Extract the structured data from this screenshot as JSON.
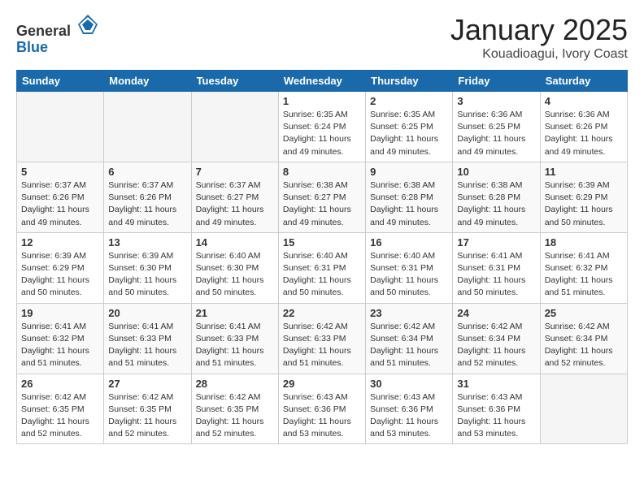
{
  "header": {
    "logo_general": "General",
    "logo_blue": "Blue",
    "title": "January 2025",
    "subtitle": "Kouadioagui, Ivory Coast"
  },
  "days_of_week": [
    "Sunday",
    "Monday",
    "Tuesday",
    "Wednesday",
    "Thursday",
    "Friday",
    "Saturday"
  ],
  "weeks": [
    [
      {
        "num": "",
        "info": "",
        "empty": true
      },
      {
        "num": "",
        "info": "",
        "empty": true
      },
      {
        "num": "",
        "info": "",
        "empty": true
      },
      {
        "num": "1",
        "sunrise": "6:35 AM",
        "sunset": "6:24 PM",
        "daylight": "11 hours and 49 minutes."
      },
      {
        "num": "2",
        "sunrise": "6:35 AM",
        "sunset": "6:25 PM",
        "daylight": "11 hours and 49 minutes."
      },
      {
        "num": "3",
        "sunrise": "6:36 AM",
        "sunset": "6:25 PM",
        "daylight": "11 hours and 49 minutes."
      },
      {
        "num": "4",
        "sunrise": "6:36 AM",
        "sunset": "6:26 PM",
        "daylight": "11 hours and 49 minutes."
      }
    ],
    [
      {
        "num": "5",
        "sunrise": "6:37 AM",
        "sunset": "6:26 PM",
        "daylight": "11 hours and 49 minutes."
      },
      {
        "num": "6",
        "sunrise": "6:37 AM",
        "sunset": "6:26 PM",
        "daylight": "11 hours and 49 minutes."
      },
      {
        "num": "7",
        "sunrise": "6:37 AM",
        "sunset": "6:27 PM",
        "daylight": "11 hours and 49 minutes."
      },
      {
        "num": "8",
        "sunrise": "6:38 AM",
        "sunset": "6:27 PM",
        "daylight": "11 hours and 49 minutes."
      },
      {
        "num": "9",
        "sunrise": "6:38 AM",
        "sunset": "6:28 PM",
        "daylight": "11 hours and 49 minutes."
      },
      {
        "num": "10",
        "sunrise": "6:38 AM",
        "sunset": "6:28 PM",
        "daylight": "11 hours and 49 minutes."
      },
      {
        "num": "11",
        "sunrise": "6:39 AM",
        "sunset": "6:29 PM",
        "daylight": "11 hours and 50 minutes."
      }
    ],
    [
      {
        "num": "12",
        "sunrise": "6:39 AM",
        "sunset": "6:29 PM",
        "daylight": "11 hours and 50 minutes."
      },
      {
        "num": "13",
        "sunrise": "6:39 AM",
        "sunset": "6:30 PM",
        "daylight": "11 hours and 50 minutes."
      },
      {
        "num": "14",
        "sunrise": "6:40 AM",
        "sunset": "6:30 PM",
        "daylight": "11 hours and 50 minutes."
      },
      {
        "num": "15",
        "sunrise": "6:40 AM",
        "sunset": "6:31 PM",
        "daylight": "11 hours and 50 minutes."
      },
      {
        "num": "16",
        "sunrise": "6:40 AM",
        "sunset": "6:31 PM",
        "daylight": "11 hours and 50 minutes."
      },
      {
        "num": "17",
        "sunrise": "6:41 AM",
        "sunset": "6:31 PM",
        "daylight": "11 hours and 50 minutes."
      },
      {
        "num": "18",
        "sunrise": "6:41 AM",
        "sunset": "6:32 PM",
        "daylight": "11 hours and 51 minutes."
      }
    ],
    [
      {
        "num": "19",
        "sunrise": "6:41 AM",
        "sunset": "6:32 PM",
        "daylight": "11 hours and 51 minutes."
      },
      {
        "num": "20",
        "sunrise": "6:41 AM",
        "sunset": "6:33 PM",
        "daylight": "11 hours and 51 minutes."
      },
      {
        "num": "21",
        "sunrise": "6:41 AM",
        "sunset": "6:33 PM",
        "daylight": "11 hours and 51 minutes."
      },
      {
        "num": "22",
        "sunrise": "6:42 AM",
        "sunset": "6:33 PM",
        "daylight": "11 hours and 51 minutes."
      },
      {
        "num": "23",
        "sunrise": "6:42 AM",
        "sunset": "6:34 PM",
        "daylight": "11 hours and 51 minutes."
      },
      {
        "num": "24",
        "sunrise": "6:42 AM",
        "sunset": "6:34 PM",
        "daylight": "11 hours and 52 minutes."
      },
      {
        "num": "25",
        "sunrise": "6:42 AM",
        "sunset": "6:34 PM",
        "daylight": "11 hours and 52 minutes."
      }
    ],
    [
      {
        "num": "26",
        "sunrise": "6:42 AM",
        "sunset": "6:35 PM",
        "daylight": "11 hours and 52 minutes."
      },
      {
        "num": "27",
        "sunrise": "6:42 AM",
        "sunset": "6:35 PM",
        "daylight": "11 hours and 52 minutes."
      },
      {
        "num": "28",
        "sunrise": "6:42 AM",
        "sunset": "6:35 PM",
        "daylight": "11 hours and 52 minutes."
      },
      {
        "num": "29",
        "sunrise": "6:43 AM",
        "sunset": "6:36 PM",
        "daylight": "11 hours and 53 minutes."
      },
      {
        "num": "30",
        "sunrise": "6:43 AM",
        "sunset": "6:36 PM",
        "daylight": "11 hours and 53 minutes."
      },
      {
        "num": "31",
        "sunrise": "6:43 AM",
        "sunset": "6:36 PM",
        "daylight": "11 hours and 53 minutes."
      },
      {
        "num": "",
        "info": "",
        "empty": true
      }
    ]
  ]
}
